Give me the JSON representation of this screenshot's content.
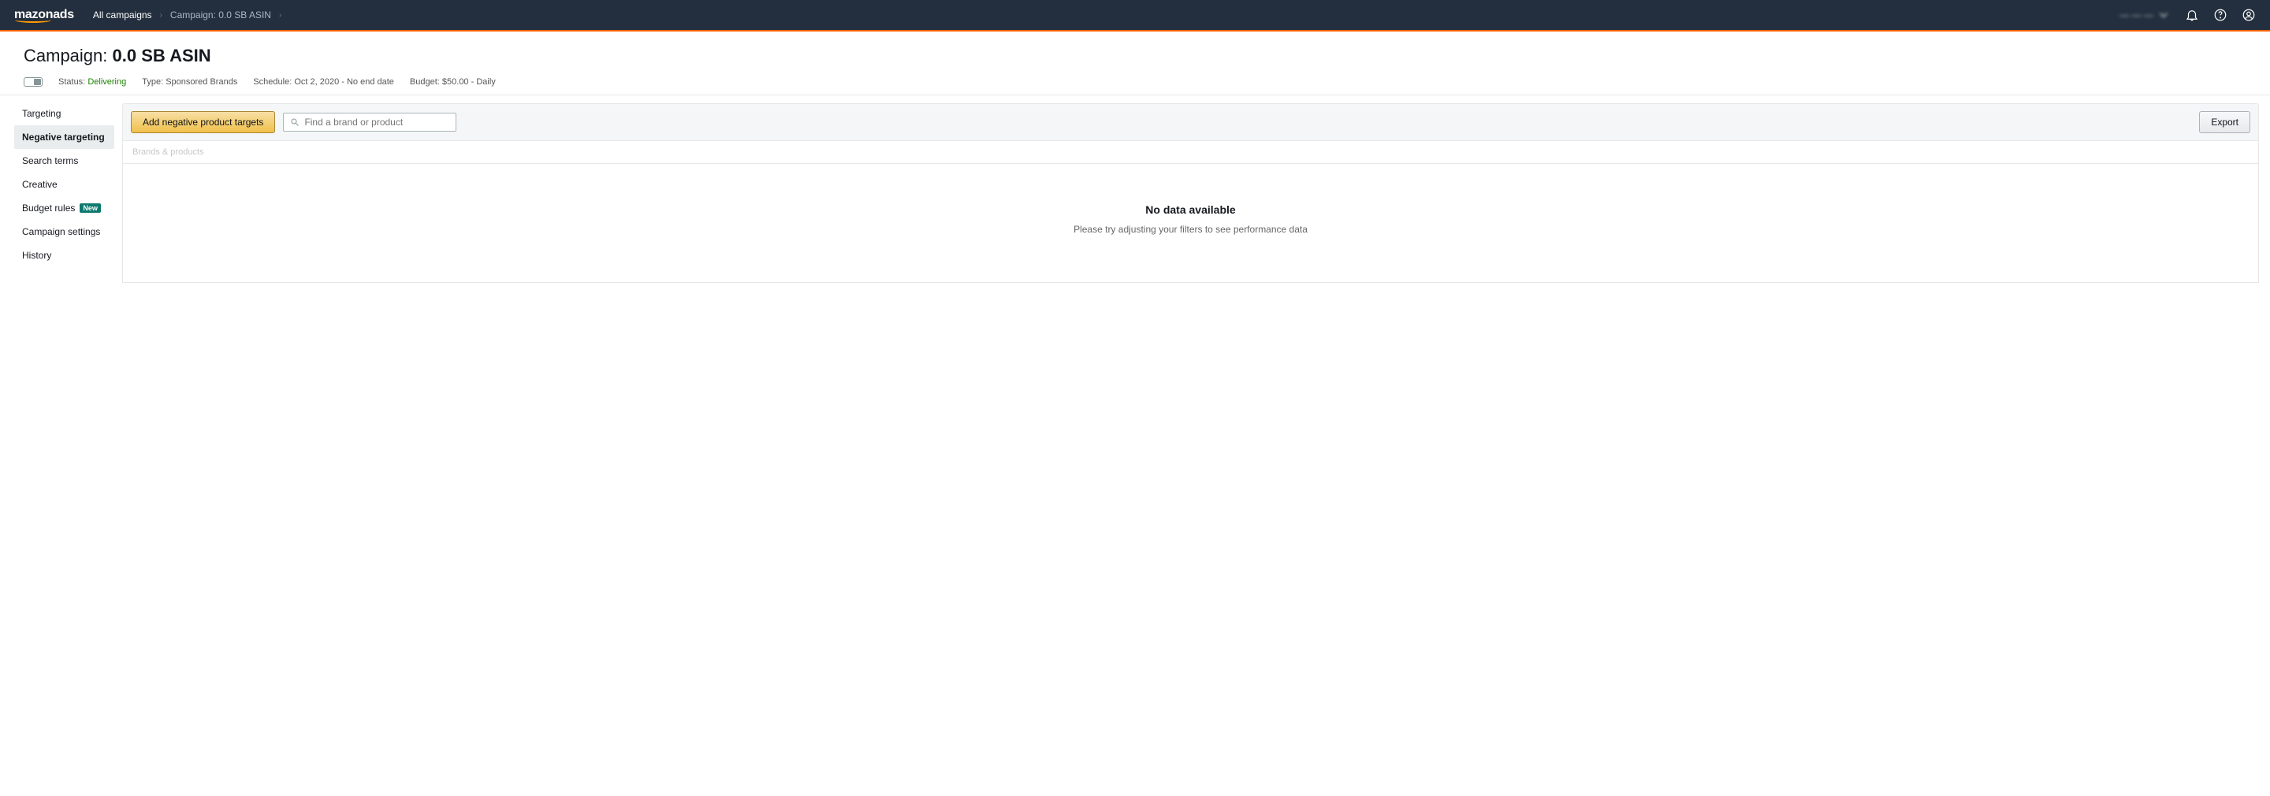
{
  "topnav": {
    "logo_left": "mazon",
    "logo_right": "ads",
    "breadcrumbs": [
      "All campaigns",
      "Campaign: 0.0 SB ASIN"
    ],
    "account_label": "— — —"
  },
  "header": {
    "title_prefix": "Campaign: ",
    "title_name": "0.0 SB ASIN",
    "status_label": "Status:",
    "status_value": "Delivering",
    "type_label": "Type:",
    "type_value": "Sponsored Brands",
    "schedule_label": "Schedule:",
    "schedule_value": "Oct 2, 2020 - No end date",
    "budget_label": "Budget:",
    "budget_value": "$50.00 - Daily"
  },
  "sidebar": {
    "items": [
      {
        "label": "Targeting",
        "active": false,
        "badge": null
      },
      {
        "label": "Negative targeting",
        "active": true,
        "badge": null
      },
      {
        "label": "Search terms",
        "active": false,
        "badge": null
      },
      {
        "label": "Creative",
        "active": false,
        "badge": null
      },
      {
        "label": "Budget rules",
        "active": false,
        "badge": "New"
      },
      {
        "label": "Campaign settings",
        "active": false,
        "badge": null
      },
      {
        "label": "History",
        "active": false,
        "badge": null
      }
    ]
  },
  "toolbar": {
    "add_button": "Add negative product targets",
    "search_placeholder": "Find a brand or product",
    "export_button": "Export"
  },
  "table": {
    "header": "Brands & products",
    "empty_title": "No data available",
    "empty_subtitle": "Please try adjusting your filters to see performance data"
  }
}
